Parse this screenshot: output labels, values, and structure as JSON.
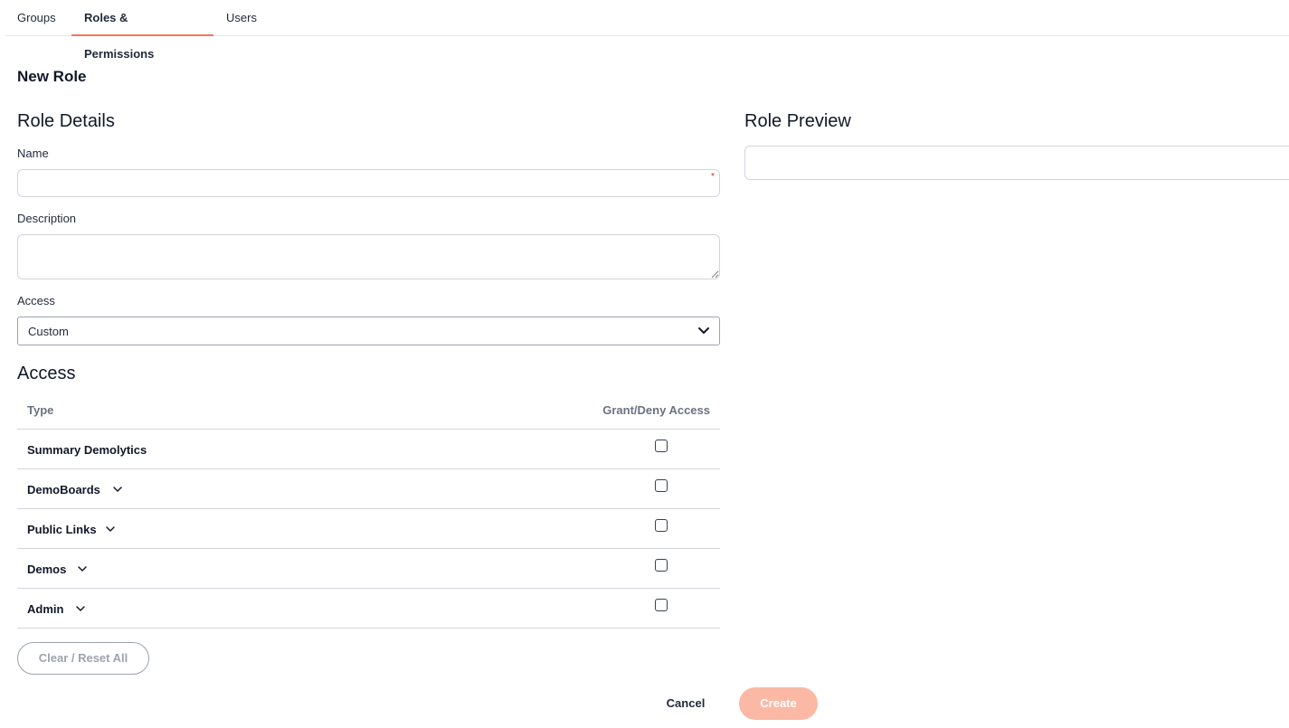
{
  "tabs": [
    {
      "label": "Groups",
      "active": false
    },
    {
      "label": "Roles & Permissions",
      "active": true
    },
    {
      "label": "Users",
      "active": false
    }
  ],
  "page_title": "New Role",
  "role_details": {
    "title": "Role Details",
    "name_label": "Name",
    "name_value": "",
    "required_marker": "*",
    "description_label": "Description",
    "description_value": "",
    "access_label": "Access",
    "access_selected": "Custom"
  },
  "role_preview": {
    "title": "Role Preview"
  },
  "access": {
    "title": "Access",
    "columns": [
      "Type",
      "Grant/Deny Access"
    ],
    "rows": [
      {
        "label": "Summary Demolytics",
        "expandable": false,
        "checked": false
      },
      {
        "label": "DemoBoards",
        "expandable": true,
        "checked": false
      },
      {
        "label": "Public Links",
        "expandable": true,
        "checked": false
      },
      {
        "label": "Demos",
        "expandable": true,
        "checked": false
      },
      {
        "label": "Admin",
        "expandable": true,
        "checked": false
      }
    ]
  },
  "buttons": {
    "reset": "Clear / Reset All",
    "cancel": "Cancel",
    "create": "Create"
  },
  "colors": {
    "accent": "#f07b52",
    "create_disabled": "#fbb9a5"
  },
  "icons": {
    "select": "chevron-down-icon",
    "row_expand": "chevron-down-icon"
  }
}
